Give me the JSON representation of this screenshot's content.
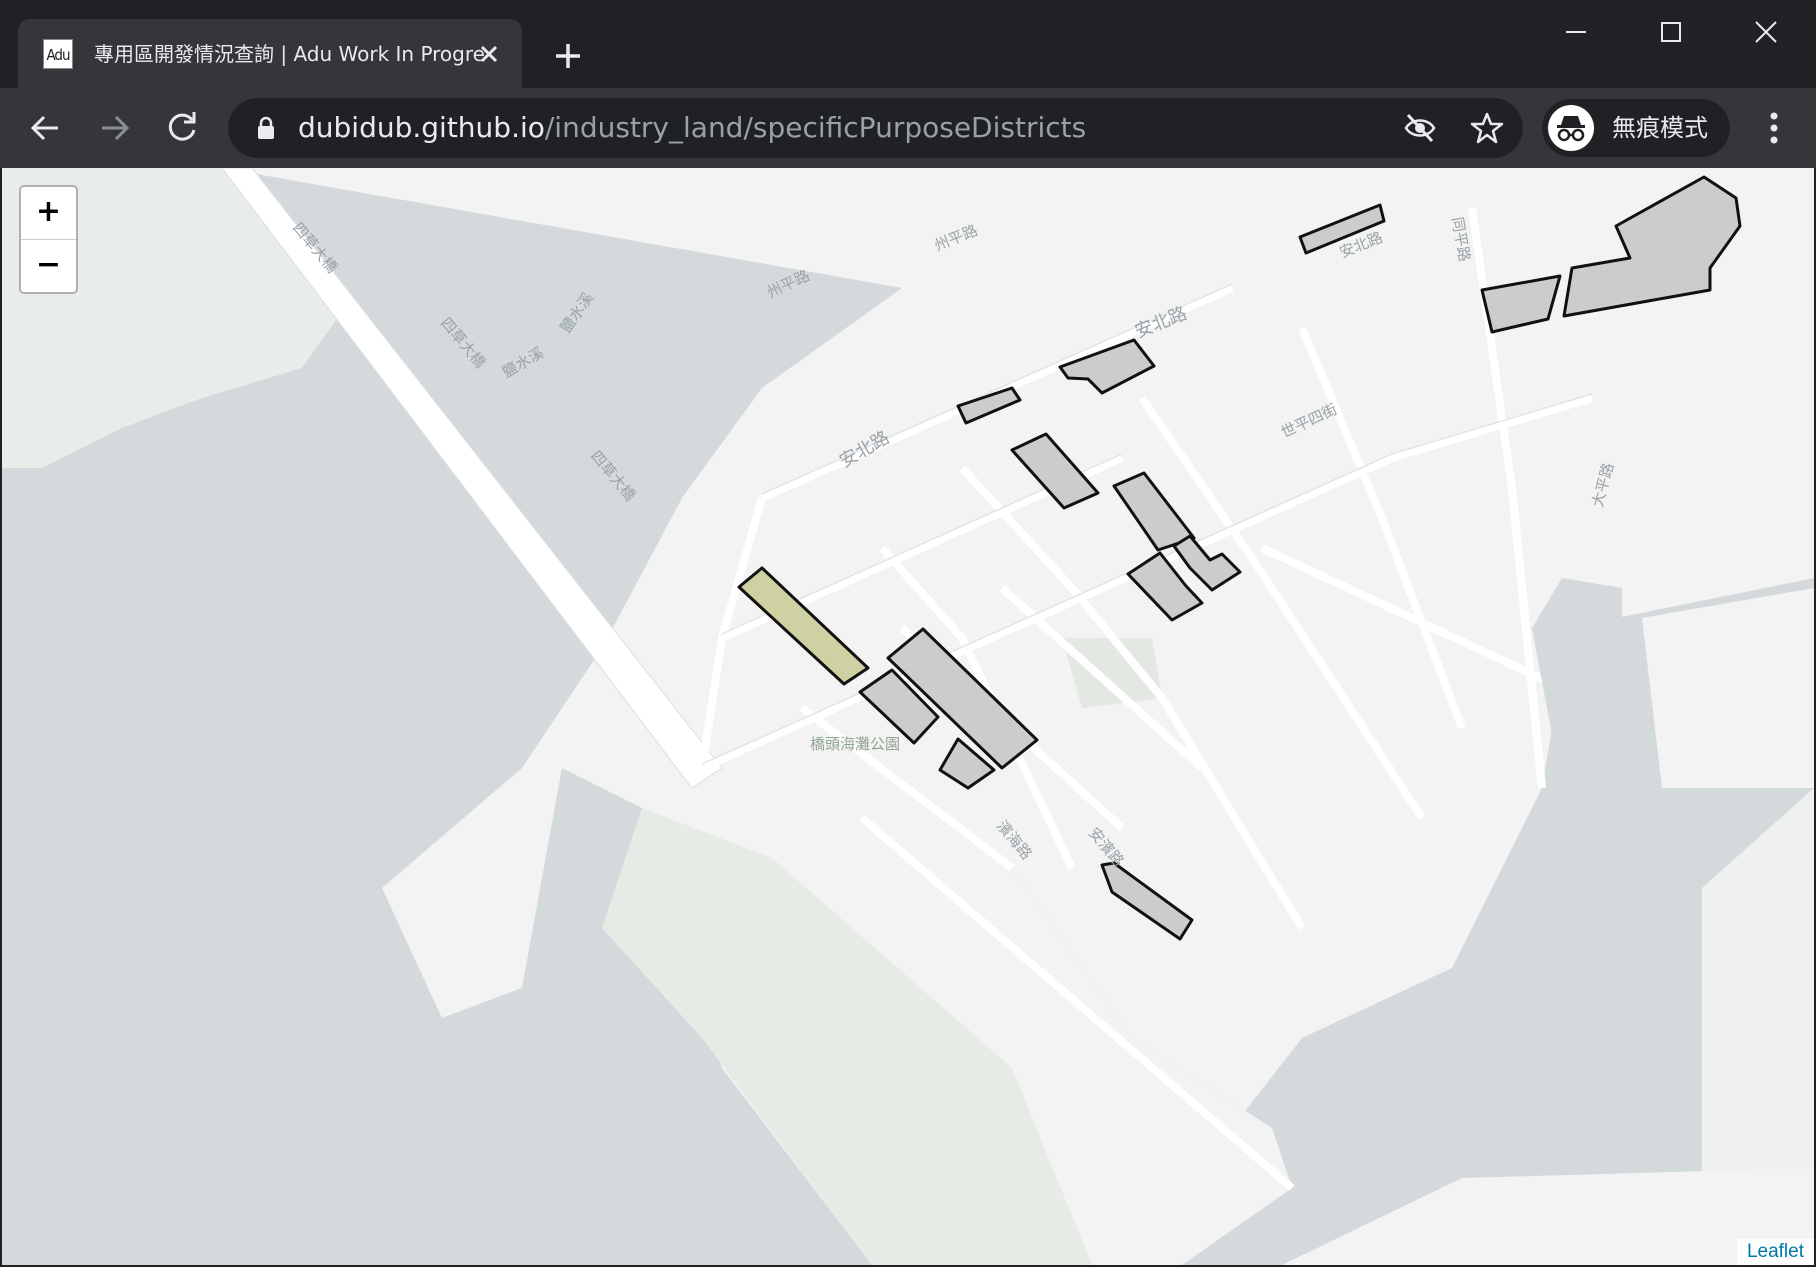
{
  "tab": {
    "favicon_text": "Adu",
    "title": "專用區開發情況查詢 | Adu Work In Progress",
    "close_icon": "close-icon"
  },
  "address_bar": {
    "host": "dubidub.github.io",
    "path": "/industry_land/specificPurposeDistricts"
  },
  "profile": {
    "label": "無痕模式"
  },
  "map": {
    "zoom_in": "+",
    "zoom_out": "−",
    "attribution": "Leaflet",
    "labels": {
      "bridge_1": "四草大橋",
      "bridge_2": "四草大橋",
      "bridge_3": "四草大橋",
      "creek_1": "鹽水溪",
      "creek_2": "鹽水溪",
      "road_anbei_1": "安北路",
      "road_anbei_2": "安北路",
      "road_anbei_3": "安北路",
      "road_zhouping": "州平路",
      "road_zhouping_2": "州平路",
      "park": "橋頭海灘公園",
      "road_haibin": "濱海路",
      "road_anbin": "安濱路",
      "road_shiping4": "世平四街",
      "road_tongping": "同平路",
      "road_daping": "大平路"
    },
    "colors": {
      "district_fill": "#cccccc",
      "highlight_fill": "#cfd1a2",
      "outline": "#111111"
    }
  }
}
